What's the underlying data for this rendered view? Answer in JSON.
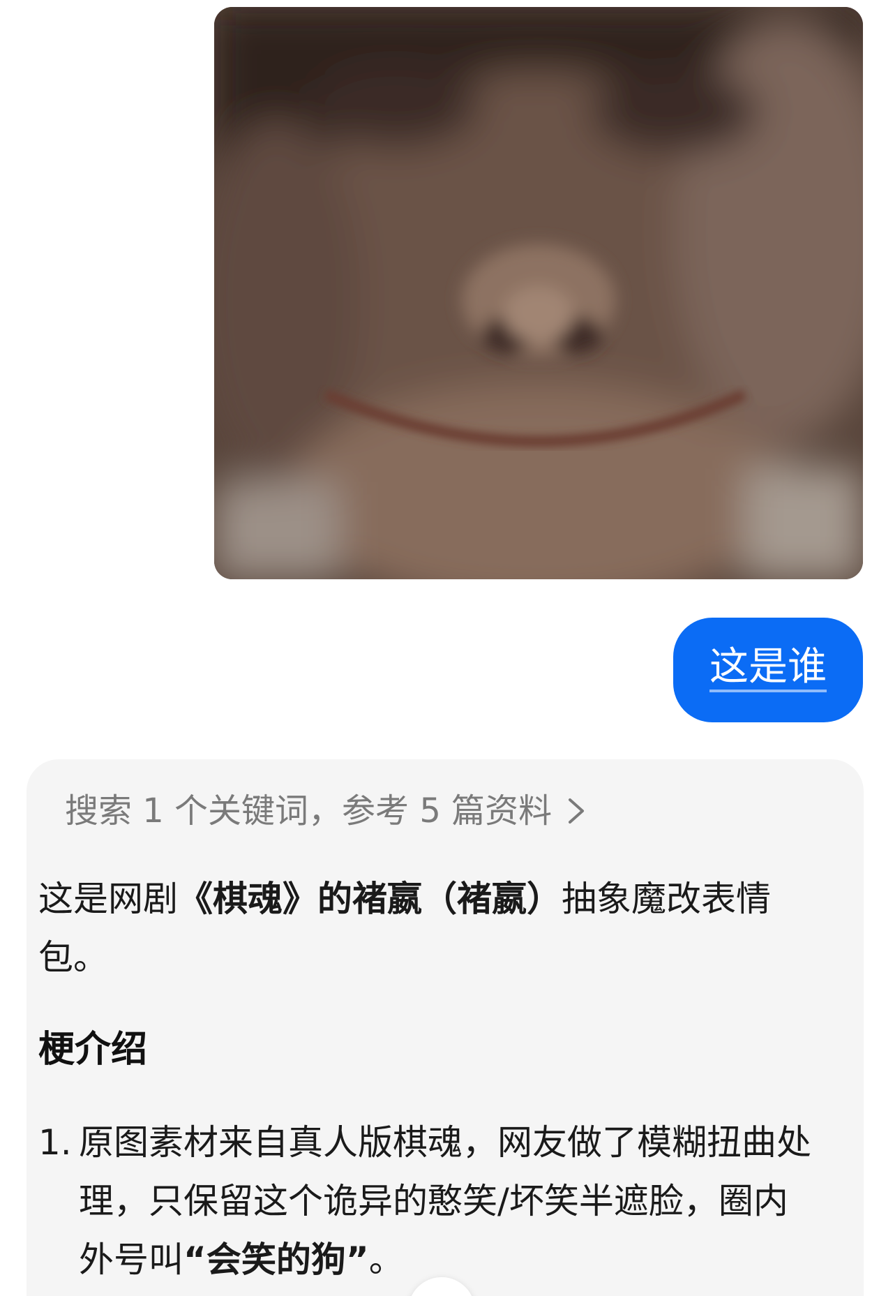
{
  "user_message": {
    "image_alt_icon": "blurred-face-meme-image",
    "text": "这是谁"
  },
  "ai_reply": {
    "search_summary": "搜索 1 个关键词，参考 5 篇资料",
    "answer_parts": [
      "这是网剧",
      "《棋魂》的褚嬴（褚嬴）",
      "抽象魔改表情包。"
    ],
    "section_title": "梗介绍",
    "list_items": [
      {
        "num": "1.",
        "text_before": "原图素材来自真人版棋魂，网友做了模糊扭曲处理，只保留这个诡异的憨笑/坏笑半遮脸，圈内外号叫",
        "bold": "“会笑的狗”",
        "text_after": "。"
      }
    ]
  },
  "colors": {
    "user_bubble": "#0b6cf5",
    "card_bg": "#f5f5f5",
    "muted_text": "#7a7a7a"
  }
}
